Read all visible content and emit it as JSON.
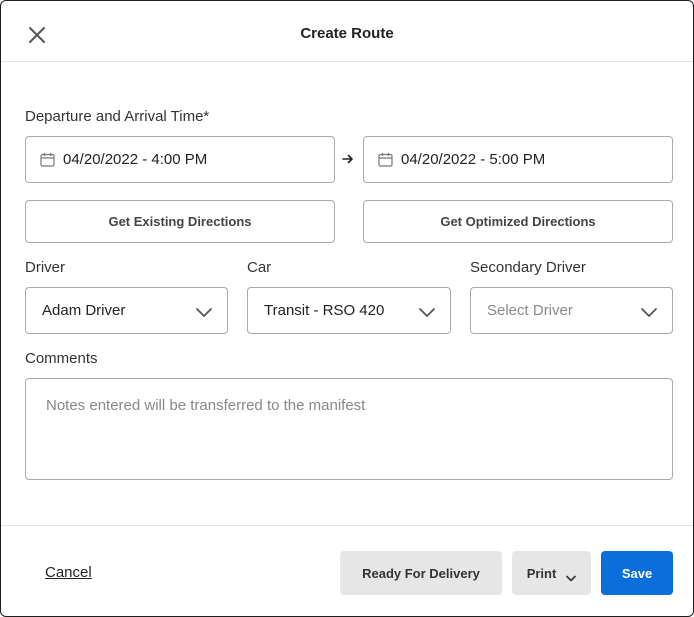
{
  "header": {
    "title": "Create Route",
    "close_icon": "close-icon"
  },
  "times": {
    "label": "Departure and Arrival Time*",
    "departure": "04/20/2022 - 4:00 PM",
    "arrival": "04/20/2022 - 5:00 PM",
    "calendar_icon": "calendar-icon",
    "arrow_icon": "arrow-right-icon"
  },
  "directions": {
    "existing_label": "Get Existing Directions",
    "optimized_label": "Get Optimized Directions"
  },
  "driver": {
    "label": "Driver",
    "value": "Adam Driver"
  },
  "car": {
    "label": "Car",
    "value": "Transit - RSO 420"
  },
  "secondary_driver": {
    "label": "Secondary Driver",
    "placeholder": "Select Driver"
  },
  "comments": {
    "label": "Comments",
    "placeholder": "Notes entered will be transferred to the manifest"
  },
  "footer": {
    "cancel_label": "Cancel",
    "ready_label": "Ready For Delivery",
    "print_label": "Print",
    "save_label": "Save"
  },
  "colors": {
    "primary": "#0a6fdc",
    "secondary_button": "#e6e6e6",
    "border": "#a9a9a9"
  }
}
